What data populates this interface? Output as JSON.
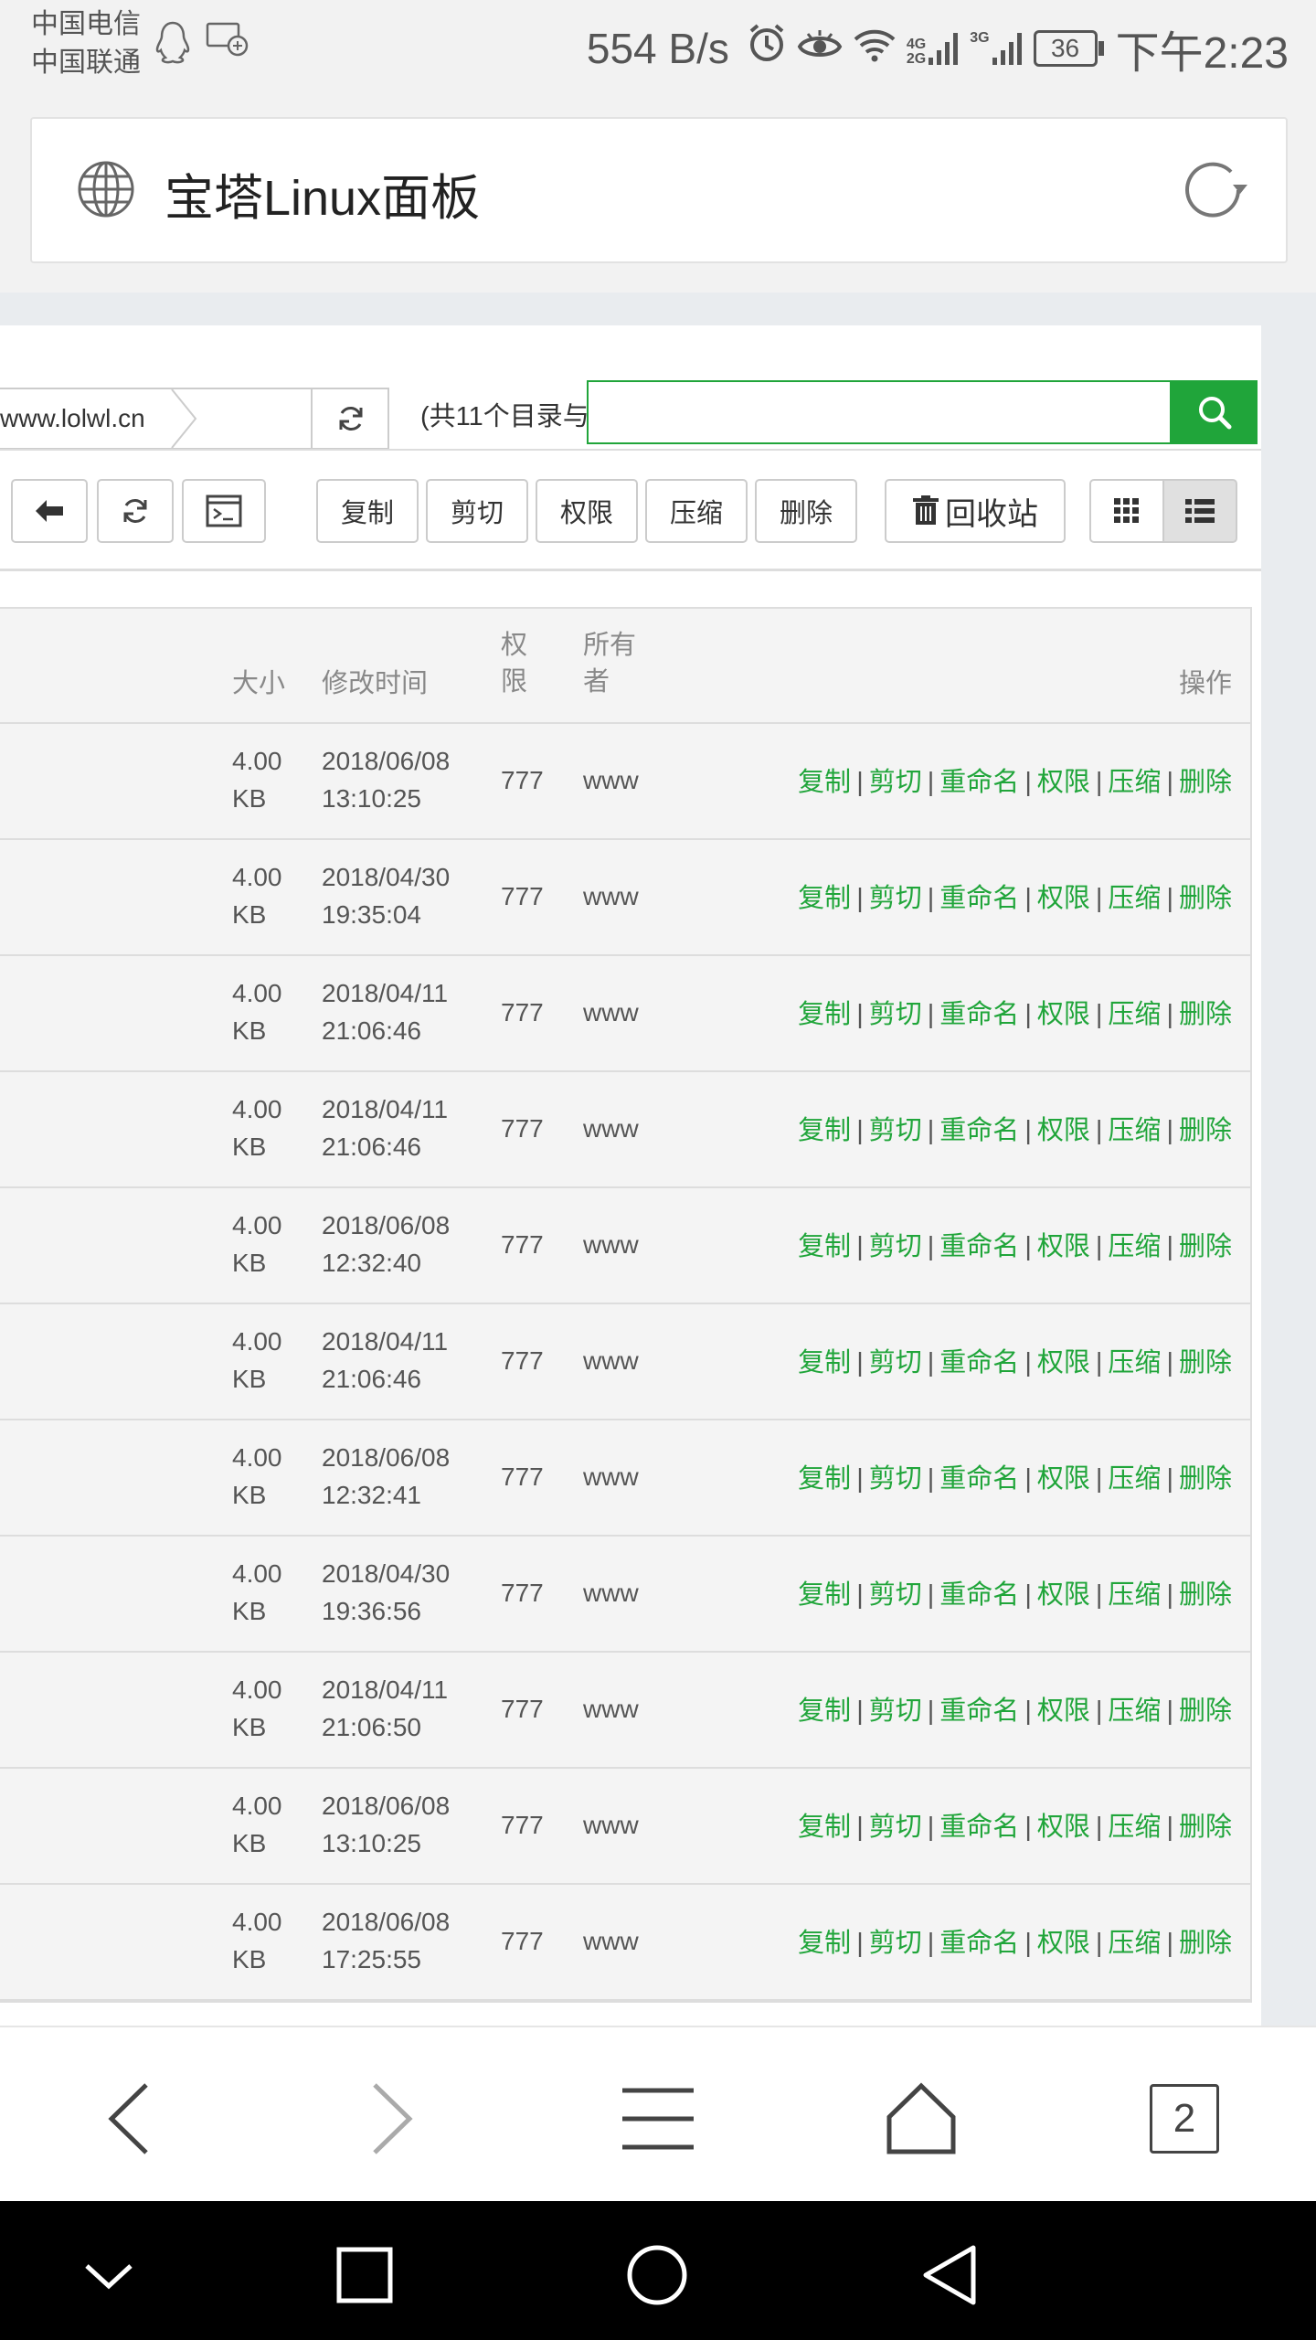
{
  "status_bar": {
    "carrier1": "中国电信",
    "carrier2": "中国联通",
    "speed": "554 B/s",
    "battery": "36",
    "time": "下午2:23",
    "network_label1": "4G",
    "network_label2": "2G",
    "network_label3": "3G"
  },
  "browser": {
    "title": "宝塔Linux面板",
    "tab_count": "2"
  },
  "file_manager": {
    "path_crumb": "www.lolwl.cn",
    "count_text": "(共11个目录与",
    "search_placeholder": "",
    "toolbar": {
      "copy": "复制",
      "cut": "剪切",
      "permission": "权限",
      "compress": "压缩",
      "delete": "删除",
      "recycle": "回收站"
    },
    "headers": {
      "size": "大小",
      "modified": "修改时间",
      "perm_line1": "权",
      "perm_line2": "限",
      "owner_line1": "所有",
      "owner_line2": "者",
      "ops": "操作"
    },
    "op_labels": {
      "copy": "复制",
      "cut": "剪切",
      "rename": "重命名",
      "perm": "权限",
      "compress": "压缩",
      "delete": "删除",
      "sep": "|"
    },
    "rows": [
      {
        "size1": "4.00",
        "size2": "KB",
        "date": "2018/06/08",
        "time": "13:10:25",
        "perm": "777",
        "owner": "www"
      },
      {
        "size1": "4.00",
        "size2": "KB",
        "date": "2018/04/30",
        "time": "19:35:04",
        "perm": "777",
        "owner": "www"
      },
      {
        "size1": "4.00",
        "size2": "KB",
        "date": "2018/04/11",
        "time": "21:06:46",
        "perm": "777",
        "owner": "www"
      },
      {
        "size1": "4.00",
        "size2": "KB",
        "date": "2018/04/11",
        "time": "21:06:46",
        "perm": "777",
        "owner": "www"
      },
      {
        "size1": "4.00",
        "size2": "KB",
        "date": "2018/06/08",
        "time": "12:32:40",
        "perm": "777",
        "owner": "www"
      },
      {
        "size1": "4.00",
        "size2": "KB",
        "date": "2018/04/11",
        "time": "21:06:46",
        "perm": "777",
        "owner": "www"
      },
      {
        "size1": "4.00",
        "size2": "KB",
        "date": "2018/06/08",
        "time": "12:32:41",
        "perm": "777",
        "owner": "www"
      },
      {
        "size1": "4.00",
        "size2": "KB",
        "date": "2018/04/30",
        "time": "19:36:56",
        "perm": "777",
        "owner": "www"
      },
      {
        "size1": "4.00",
        "size2": "KB",
        "date": "2018/04/11",
        "time": "21:06:50",
        "perm": "777",
        "owner": "www"
      },
      {
        "size1": "4.00",
        "size2": "KB",
        "date": "2018/06/08",
        "time": "13:10:25",
        "perm": "777",
        "owner": "www"
      },
      {
        "size1": "4.00",
        "size2": "KB",
        "date": "2018/06/08",
        "time": "17:25:55",
        "perm": "777",
        "owner": "www"
      }
    ]
  },
  "colors": {
    "accent_green": "#20a53a",
    "background_grey": "#f2f2f2"
  },
  "icons": [
    "qq-icon",
    "screen-cast-icon",
    "alarm-icon",
    "eye-icon",
    "wifi-icon",
    "signal-icon",
    "globe-icon",
    "reload-icon",
    "refresh-icon",
    "search-icon",
    "back-arrow-icon",
    "terminal-icon",
    "trash-icon",
    "grid-view-icon",
    "list-view-icon",
    "nav-back-icon",
    "nav-forward-icon",
    "menu-icon",
    "home-icon",
    "system-back-icon",
    "system-home-icon",
    "system-recents-icon",
    "system-collapse-icon"
  ]
}
